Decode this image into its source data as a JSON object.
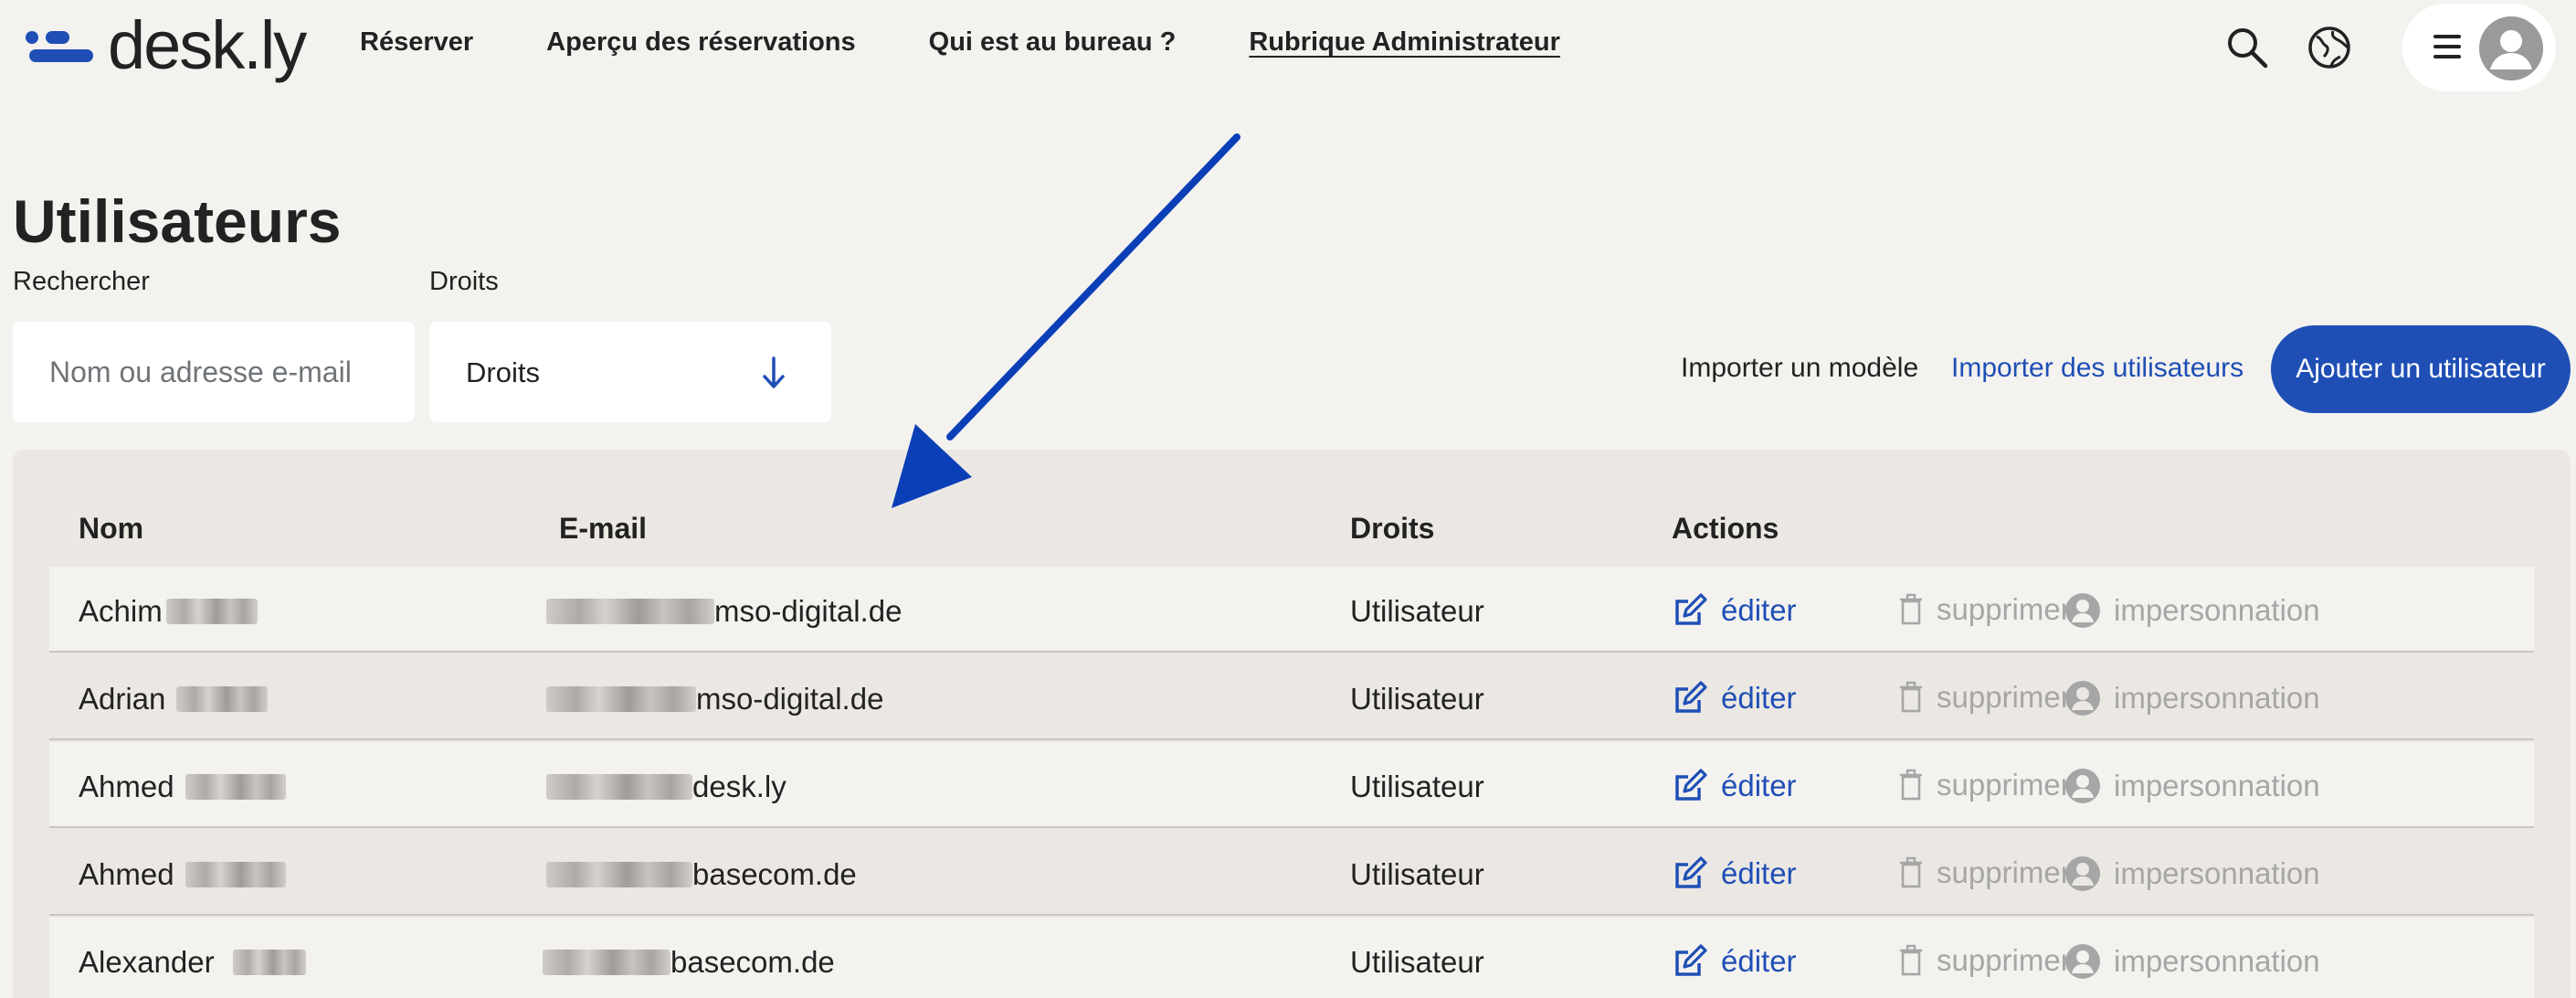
{
  "brand": {
    "name": "desk.ly",
    "color": "#1f4fb5"
  },
  "nav": {
    "items": [
      {
        "label": "Réserver",
        "active": false
      },
      {
        "label": "Aperçu des réservations",
        "active": false
      },
      {
        "label": "Qui est au bureau ?",
        "active": false
      },
      {
        "label": "Rubrique Administrateur",
        "active": true
      }
    ],
    "icons": [
      "search-icon",
      "globe-icon",
      "menu-icon",
      "avatar-icon"
    ]
  },
  "page": {
    "title": "Utilisateurs",
    "search": {
      "label": "Rechercher",
      "placeholder": "Nom ou adresse e-mail",
      "value": ""
    },
    "rights_filter": {
      "label": "Droits",
      "value": "Droits"
    },
    "actions": {
      "import_template": "Importer un modèle",
      "import_users": "Importer des utilisateurs",
      "add_user": "Ajouter un utilisateur"
    }
  },
  "table": {
    "columns": [
      "Nom",
      "E-mail",
      "Droits",
      "Actions"
    ],
    "action_labels": {
      "edit": "éditer",
      "delete": "supprimer",
      "impersonate": "impersonnation"
    },
    "rows": [
      {
        "first_name": "Achim",
        "email_domain": "mso-digital.de",
        "rights": "Utilisateur"
      },
      {
        "first_name": "Adrian",
        "email_domain": "mso-digital.de",
        "rights": "Utilisateur"
      },
      {
        "first_name": "Ahmed",
        "email_domain": "desk.ly",
        "rights": "Utilisateur"
      },
      {
        "first_name": "Ahmed",
        "email_domain": "basecom.de",
        "rights": "Utilisateur"
      },
      {
        "first_name": "Alexander",
        "email_domain": "basecom.de",
        "rights": "Utilisateur"
      }
    ]
  },
  "colors": {
    "accent": "#1f4fb5",
    "background": "#f3f2ef",
    "muted": "#a6a6a6",
    "annotation_arrow": "#0b3fb8"
  }
}
